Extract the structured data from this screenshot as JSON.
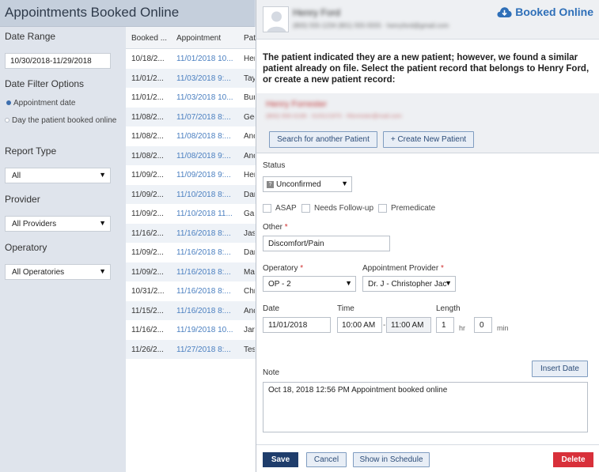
{
  "page": {
    "title": "Appointments Booked Online"
  },
  "filters": {
    "date_range_label": "Date Range",
    "date_range_value": "10/30/2018-11/29/2018",
    "date_filter_label": "Date Filter Options",
    "option_appointment_date": "Appointment date",
    "option_booked_day": "Day the patient booked online",
    "report_type_label": "Report Type",
    "report_type_value": "All",
    "provider_label": "Provider",
    "provider_value": "All Providers",
    "operatory_label": "Operatory",
    "operatory_value": "All Operatories"
  },
  "table": {
    "columns": [
      "Booked ...",
      "Appointment",
      "Pat"
    ],
    "rows": [
      [
        "10/18/2...",
        "11/01/2018 10...",
        "Hen"
      ],
      [
        "11/01/2...",
        "11/03/2018 9:...",
        "Tay"
      ],
      [
        "11/01/2...",
        "11/03/2018 10...",
        "Bur"
      ],
      [
        "11/08/2...",
        "11/07/2018 8:...",
        "Geo"
      ],
      [
        "11/08/2...",
        "11/08/2018 8:...",
        "And"
      ],
      [
        "11/08/2...",
        "11/08/2018 9:...",
        "And"
      ],
      [
        "11/09/2...",
        "11/09/2018 9:...",
        "Hen"
      ],
      [
        "11/09/2...",
        "11/10/2018 8:...",
        "Dar"
      ],
      [
        "11/09/2...",
        "11/10/2018 11...",
        "Gab"
      ],
      [
        "11/16/2...",
        "11/16/2018 8:...",
        "Jas"
      ],
      [
        "11/09/2...",
        "11/16/2018 8:...",
        "Dar"
      ],
      [
        "11/09/2...",
        "11/16/2018 8:...",
        "Mar"
      ],
      [
        "10/31/2...",
        "11/16/2018 8:...",
        "Chr"
      ],
      [
        "11/15/2...",
        "11/16/2018 8:...",
        "And"
      ],
      [
        "11/16/2...",
        "11/19/2018 10...",
        "Jar"
      ],
      [
        "11/26/2...",
        "11/27/2018 8:...",
        "Tes"
      ]
    ]
  },
  "modal": {
    "patient_name": "Henry Ford",
    "patient_details": "(800) 555-1234 (801) 555-5555 · henryford@gmail.com",
    "brand": "Booked Online",
    "notice": "The patient indicated they are a new patient; however, we found a similar patient already on file. Select the patient record that belongs to Henry Ford, or create a new patient record:",
    "similar_name": "Henry Forrester",
    "similar_details": "(800) 555-0199 · 01/01/1970 · hforrester@mail.com",
    "search_another_label": "Search for another Patient",
    "create_new_label": "+ Create New Patient",
    "status_label": "Status",
    "status_value": "Unconfirmed",
    "asap_label": "ASAP",
    "followup_label": "Needs Follow-up",
    "premedicate_label": "Premedicate",
    "other_label": "Other",
    "other_value": "Discomfort/Pain",
    "operatory_label": "Operatory",
    "operatory_value": "OP - 2",
    "provider_label": "Appointment Provider",
    "provider_value": "Dr. J - Christopher Jac",
    "date_label": "Date",
    "date_value": "11/01/2018",
    "time_label": "Time",
    "time_start": "10:00 AM",
    "time_sep": "-",
    "time_end": "11:00 AM",
    "length_label": "Length",
    "length_hr": "1",
    "hr_unit": "hr",
    "length_min": "0",
    "min_unit": "min",
    "note_label": "Note",
    "insert_date_label": "Insert Date",
    "note_value": "Oct 18, 2018 12:56 PM Appointment booked online",
    "save_label": "Save",
    "cancel_label": "Cancel",
    "show_schedule_label": "Show in Schedule",
    "delete_label": "Delete",
    "required_mark": "*"
  }
}
